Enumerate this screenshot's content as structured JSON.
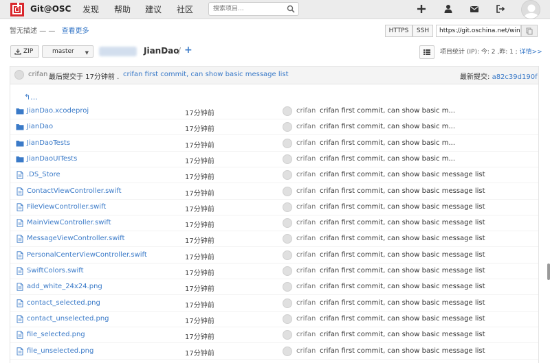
{
  "header": {
    "brand": "Git@OSC",
    "nav": [
      "发现",
      "帮助",
      "建议",
      "社区"
    ],
    "search_placeholder": "搜索项目..."
  },
  "repo": {
    "description": "暂无描述",
    "description_dash": "— —",
    "see_more": "查看更多",
    "https_label": "HTTPS",
    "ssh_label": "SSH",
    "clone_url": "https://git.oschina.net/win",
    "zip_label": "ZIP",
    "branch": "master",
    "name": "JianDao",
    "separator": "/",
    "add_label": "+",
    "stats": "项目统计 (IP): 今: 2 ,昨: 1 ;",
    "stats_detail": "详情>>"
  },
  "last_commit": {
    "author": "crifan",
    "when": "最后提交于 17分钟前 .",
    "message": "crifan first commit, can show basic message list",
    "latest_label": "最新提交:",
    "sha": "a82c39d190f"
  },
  "up_label": "↰...",
  "files": [
    {
      "name": "JianDao.xcodeproj",
      "type": "folder",
      "time": "17分钟前",
      "author": "crifan",
      "message": "crifan first commit, can show basic m..."
    },
    {
      "name": "JianDao",
      "type": "folder",
      "time": "17分钟前",
      "author": "crifan",
      "message": "crifan first commit, can show basic m..."
    },
    {
      "name": "JianDaoTests",
      "type": "folder",
      "time": "17分钟前",
      "author": "crifan",
      "message": "crifan first commit, can show basic m..."
    },
    {
      "name": "JianDaoUITests",
      "type": "folder",
      "time": "17分钟前",
      "author": "crifan",
      "message": "crifan first commit, can show basic m..."
    },
    {
      "name": ".DS_Store",
      "type": "file",
      "time": "17分钟前",
      "author": "crifan",
      "message": "crifan first commit, can show basic message list"
    },
    {
      "name": "ContactViewController.swift",
      "type": "file",
      "time": "17分钟前",
      "author": "crifan",
      "message": "crifan first commit, can show basic message list"
    },
    {
      "name": "FileViewController.swift",
      "type": "file",
      "time": "17分钟前",
      "author": "crifan",
      "message": "crifan first commit, can show basic message list"
    },
    {
      "name": "MainViewController.swift",
      "type": "file",
      "time": "17分钟前",
      "author": "crifan",
      "message": "crifan first commit, can show basic message list"
    },
    {
      "name": "MessageViewController.swift",
      "type": "file",
      "time": "17分钟前",
      "author": "crifan",
      "message": "crifan first commit, can show basic message list"
    },
    {
      "name": "PersonalCenterViewController.swift",
      "type": "file",
      "time": "17分钟前",
      "author": "crifan",
      "message": "crifan first commit, can show basic message list"
    },
    {
      "name": "SwiftColors.swift",
      "type": "file",
      "time": "17分钟前",
      "author": "crifan",
      "message": "crifan first commit, can show basic message list"
    },
    {
      "name": "add_white_24x24.png",
      "type": "file",
      "time": "17分钟前",
      "author": "crifan",
      "message": "crifan first commit, can show basic message list"
    },
    {
      "name": "contact_selected.png",
      "type": "file",
      "time": "17分钟前",
      "author": "crifan",
      "message": "crifan first commit, can show basic message list"
    },
    {
      "name": "contact_unselected.png",
      "type": "file",
      "time": "17分钟前",
      "author": "crifan",
      "message": "crifan first commit, can show basic message list"
    },
    {
      "name": "file_selected.png",
      "type": "file",
      "time": "17分钟前",
      "author": "crifan",
      "message": "crifan first commit, can show basic message list"
    },
    {
      "name": "file_unselected.png",
      "type": "file",
      "time": "17分钟前",
      "author": "crifan",
      "message": "crifan first commit, can show basic message list"
    }
  ],
  "icons": {
    "folder": "folder-icon",
    "file": "file-icon"
  },
  "colors": {
    "link": "#3a7ac8",
    "brand_red": "#d9262b",
    "folder": "#3a7ac8"
  }
}
